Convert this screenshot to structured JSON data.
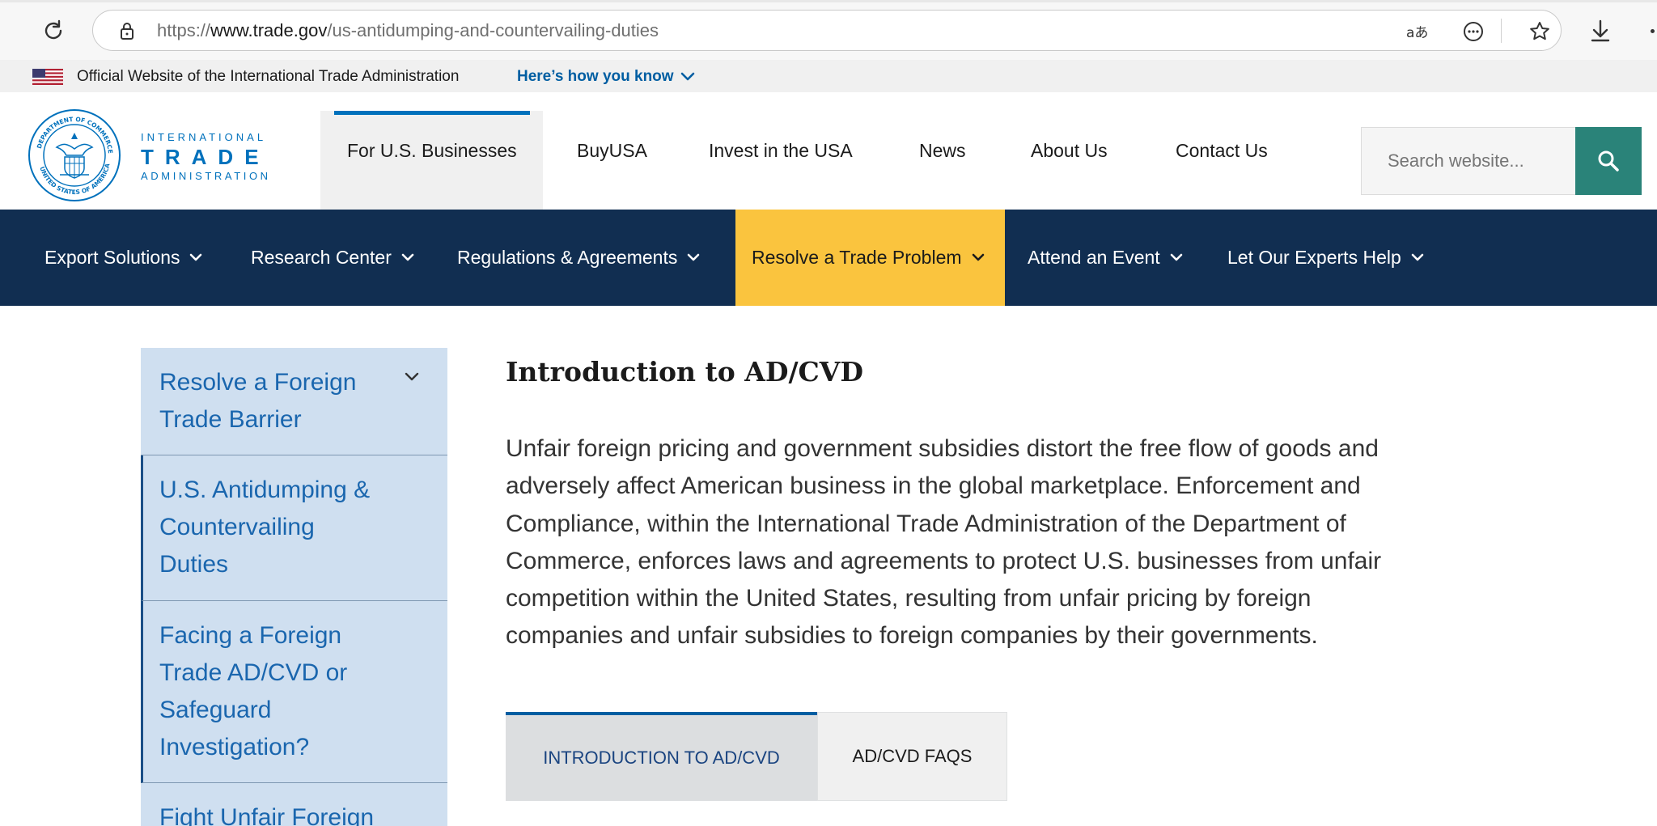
{
  "browser": {
    "url_prefix": "https://",
    "url_host": "www.trade.gov",
    "url_path": "/us-antidumping-and-countervailing-duties",
    "icons": [
      "reload-icon",
      "lock-icon",
      "read-aloud-icon",
      "more-tools-icon",
      "favorite-star-icon",
      "download-icon"
    ]
  },
  "gov_banner": {
    "text": "Official Website of the International Trade Administration",
    "link": "Here’s how you know"
  },
  "logo": {
    "line1": "INTERNATIONAL",
    "line2": "TRADE",
    "line3": "ADMINISTRATION"
  },
  "header_nav": [
    {
      "label": "For U.S. Businesses",
      "active": true
    },
    {
      "label": "BuyUSA"
    },
    {
      "label": "Invest in the USA"
    },
    {
      "label": "News"
    },
    {
      "label": "About Us"
    },
    {
      "label": "Contact Us"
    }
  ],
  "search": {
    "placeholder": "Search website..."
  },
  "mega_nav": [
    {
      "label": "Export Solutions"
    },
    {
      "label": "Research Center"
    },
    {
      "label": "Regulations & Agreements"
    },
    {
      "label": "Resolve a Trade Problem",
      "highlight": true
    },
    {
      "label": "Attend an Event"
    },
    {
      "label": "Let Our Experts Help"
    }
  ],
  "sidebar": {
    "items": [
      {
        "label_lines": [
          "Resolve a Foreign",
          "Trade Barrier"
        ],
        "expandable": true
      },
      {
        "label_lines": [
          "U.S. Antidumping &",
          "Countervailing",
          "Duties"
        ],
        "active": true
      },
      {
        "label_lines": [
          "Facing a Foreign",
          "Trade AD/CVD or",
          "Safeguard",
          "Investigation?"
        ]
      },
      {
        "label_lines": [
          "Fight Unfair Foreign"
        ]
      }
    ]
  },
  "main": {
    "title": "Introduction to AD/CVD",
    "paragraph_lines": [
      "Unfair foreign pricing and government subsidies distort the free flow of goods and",
      "adversely affect American business in the global marketplace. Enforcement and",
      "Compliance, within the International Trade Administration of the Department of",
      "Commerce, enforces laws and agreements to protect U.S. businesses from unfair",
      "competition within the United States, resulting from unfair pricing by foreign",
      "companies and unfair subsidies to foreign companies by their governments."
    ],
    "tabs": [
      {
        "label": "INTRODUCTION TO AD/CVD",
        "active": true
      },
      {
        "label": "AD/CVD FAQS"
      }
    ]
  },
  "colors": {
    "navy": "#112e51",
    "highlight_yellow": "#fac43e",
    "link_blue": "#005ea2",
    "search_green": "#2a8379",
    "sidebar_bg": "#cfdff0"
  }
}
